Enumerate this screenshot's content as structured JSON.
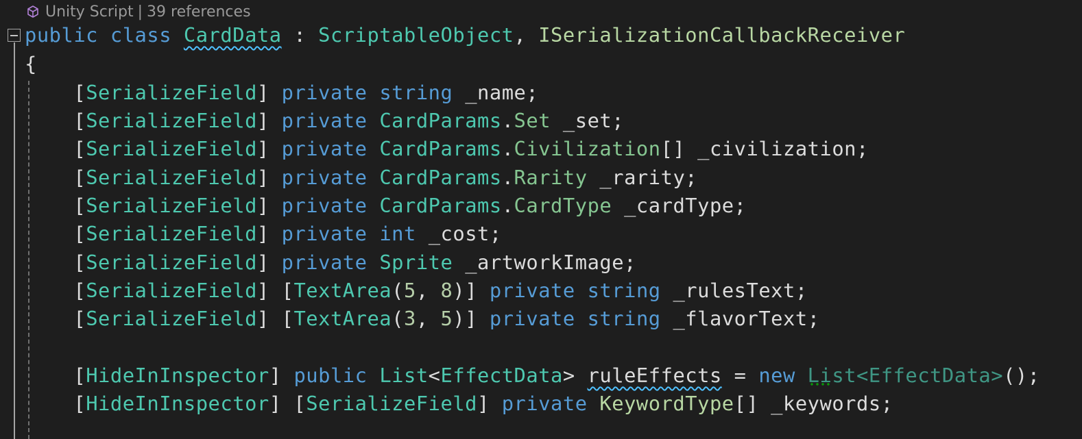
{
  "codelens": {
    "icon": "unity-cube-icon",
    "script_label": "Unity Script",
    "separator": "|",
    "references": "39 references"
  },
  "colors": {
    "background": "#1e1e1e",
    "keyword": "#569cd6",
    "type": "#4ec9b0",
    "struct": "#86c691",
    "interface": "#b8d7a3",
    "number": "#b5cea8",
    "identifier": "#dcdcdc",
    "squiggle": "#4fc1ff",
    "suggestion_dots": "#00d000"
  },
  "code": {
    "decl": {
      "public": "public",
      "class": "class",
      "name": "CardData",
      "colon": " : ",
      "base": "ScriptableObject",
      "comma": ", ",
      "iface": "ISerializationCallbackReceiver"
    },
    "open_brace": "{",
    "attr_sf": "SerializeField",
    "attr_hide": "HideInInspector",
    "attr_textarea": "TextArea",
    "kw_private": "private",
    "kw_public": "public",
    "kw_string": "string",
    "kw_int": "int",
    "kw_new": "new",
    "params": "CardParams",
    "fields": [
      {
        "type": "string",
        "name": "_name"
      },
      {
        "type": "Set",
        "name": "_set"
      },
      {
        "type": "Civilization",
        "suffix": "[]",
        "name": "_civilization"
      },
      {
        "type": "Rarity",
        "name": "_rarity"
      },
      {
        "type": "CardType",
        "name": "_cardType"
      },
      {
        "type": "int",
        "name": "_cost"
      },
      {
        "type": "Sprite",
        "name": "_artworkImage"
      },
      {
        "textarea": [
          "5",
          "8"
        ],
        "type": "string",
        "name": "_rulesText"
      },
      {
        "textarea": [
          "3",
          "5"
        ],
        "type": "string",
        "name": "_flavorText"
      }
    ],
    "rule_effects": {
      "list": "List",
      "generic": "EffectData",
      "name": "ruleEffects",
      "init": "()"
    },
    "keywords": {
      "type": "KeywordType",
      "suffix": "[]",
      "name": "_keywords"
    }
  }
}
